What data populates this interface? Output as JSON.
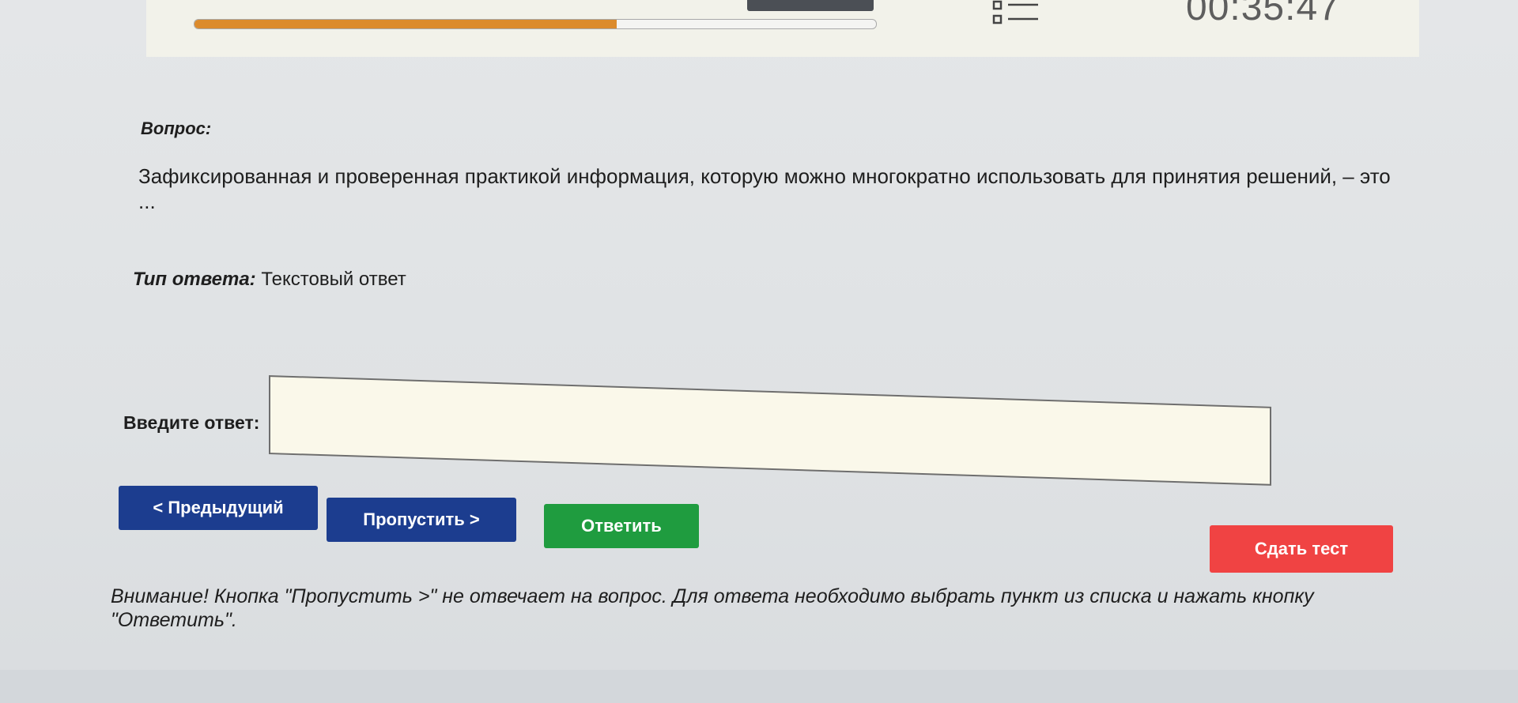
{
  "header": {
    "progress_fraction": 0.62,
    "timer": "00:35:47",
    "icons": {
      "question_list": "list-icon"
    },
    "colors": {
      "progress": "#dc8b2c",
      "panel": "#f2f2ea"
    }
  },
  "question": {
    "label": "Вопрос:",
    "text": "Зафиксированная и проверенная практикой информация, которую можно многократно использовать для принятия решений, – это ..."
  },
  "answer_type": {
    "label": "Тип ответа:",
    "value": " Текстовый ответ"
  },
  "answer": {
    "label": "Введите ответ:",
    "value": "",
    "placeholder": ""
  },
  "buttons": {
    "prev": "< Предыдущий",
    "skip": "Пропустить >",
    "answer": "Ответить",
    "submit": "Сдать тест",
    "colors": {
      "prev": "#1c3d8f",
      "skip": "#1c3d8f",
      "answer": "#1f9c3f",
      "submit": "#f04343"
    }
  },
  "warning": "Внимание! Кнопка \"Пропустить >\" не отвечает на вопрос. Для ответа необходимо выбрать пункт из списка и нажать кнопку \"Ответить\"."
}
